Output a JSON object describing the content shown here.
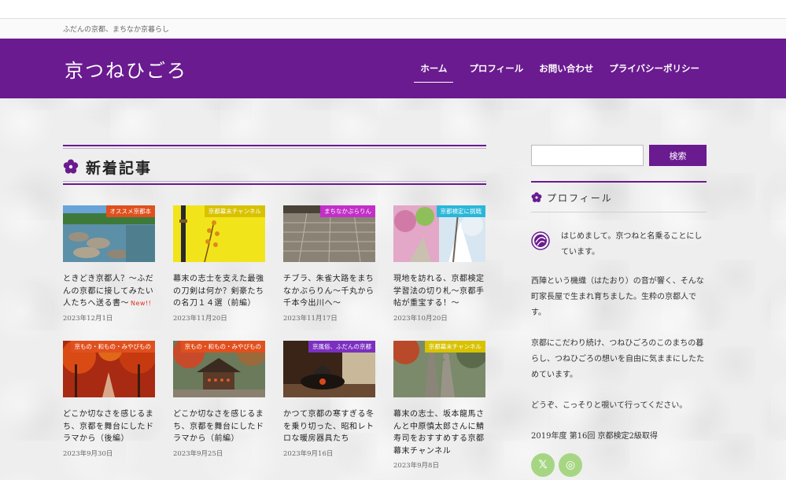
{
  "site": {
    "tagline": "ふだんの京都、まちなか京暮らし",
    "logo": "京つねひごろ"
  },
  "nav": [
    {
      "label": "ホーム"
    },
    {
      "label": "プロフィール"
    },
    {
      "label": "お問い合わせ"
    },
    {
      "label": "プライバシーポリシー"
    }
  ],
  "main": {
    "section_title": "新着記事",
    "articles": [
      {
        "category": "オススメ京都本",
        "category_color": "#e0501e",
        "title": "ときどき京都人？〜ふだんの京都に接してみたい人たちへ送る書〜",
        "new": "New!!",
        "date": "2023年12月1日"
      },
      {
        "category": "京都幕末チャンネル",
        "category_color": "#d8c200",
        "title": "幕末の志士を支えた最強の刀剣は何か？剣豪たちの名刀１４選（前編）",
        "new": "",
        "date": "2023年11月20日"
      },
      {
        "category": "まちなかぶらりん",
        "category_color": "#c22fc9",
        "title": "チブラ、朱雀大路をまちなかぶらりん〜千丸から千本今出川へ〜",
        "new": "",
        "date": "2023年11月17日"
      },
      {
        "category": "京都検定に挑戦",
        "category_color": "#29b7d9",
        "title": "現地を訪れる、京都検定学習法の切り札〜京都手帖が重宝する！〜",
        "new": "",
        "date": "2023年10月20日"
      },
      {
        "category": "京もの・和もの・みやびもの",
        "category_color": "#e0501e",
        "title": "どこか切なさを感じるまち、京都を舞台にしたドラマから（後編）",
        "new": "",
        "date": "2023年9月30日"
      },
      {
        "category": "京もの・和もの・みやびもの",
        "category_color": "#e0501e",
        "title": "どこか切なさを感じるまち、京都を舞台にしたドラマから（前編）",
        "new": "",
        "date": "2023年9月25日"
      },
      {
        "category": "京風俗、ふだんの京都",
        "category_color": "#7b2fc0",
        "title": "かつて京都の寒すぎる冬を乗り切った、昭和レトロな暖房器具たち",
        "new": "",
        "date": "2023年9月16日"
      },
      {
        "category": "京都幕末チャンネル",
        "category_color": "#d8c200",
        "title": "幕末の志士、坂本龍馬さんと中原慎太郎さんに鯖寿司をおすすめする京都幕末チャンネル",
        "new": "",
        "date": "2023年9月8日"
      }
    ]
  },
  "sidebar": {
    "search_button": "検索",
    "search_placeholder": "",
    "profile_title": "プロフィール",
    "intro": "はじめまして。京つねと名乗ることにしています。",
    "paragraphs": [
      "西陣という機織（はたおり）の音が響く、そんな町家長屋で生まれ育ちました。生粋の京都人です。",
      "京都にこだわり続け、つねひごろのこのまちの暮らし、つねひごろの想いを自由に気ままにしたためています。",
      "どうぞ、こっそりと覗いて行ってください。",
      "2019年度 第16回 京都検定2級取得"
    ],
    "social": [
      {
        "icon": "x-icon",
        "glyph": "𝕏"
      },
      {
        "icon": "instagram-icon",
        "glyph": "◎"
      }
    ]
  },
  "colors": {
    "brand": "#6a1b8f",
    "social": "#a6d684"
  }
}
